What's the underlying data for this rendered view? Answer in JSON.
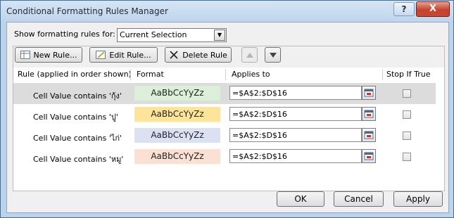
{
  "window": {
    "title": "Conditional Formatting Rules Manager",
    "help_label": "?",
    "close_label": "X"
  },
  "filter": {
    "label": "Show formatting rules for:",
    "selected": "Current Selection"
  },
  "toolbar": {
    "new_rule": "New Rule...",
    "edit_rule": "Edit Rule...",
    "delete_rule": "Delete Rule"
  },
  "columns": {
    "rule": "Rule (applied in order shown)",
    "format": "Format",
    "applies": "Applies to",
    "stop": "Stop If True"
  },
  "rules": [
    {
      "name": "Cell Value contains 'กุ้ง'",
      "preview": "AaBbCcYyZz",
      "fill": "#dcefd8",
      "applies_to": "=$A$2:$D$16",
      "stop_if_true": false
    },
    {
      "name": "Cell Value contains 'ปู'",
      "preview": "AaBbCcYyZz",
      "fill": "#fde49b",
      "applies_to": "=$A$2:$D$16",
      "stop_if_true": false
    },
    {
      "name": "Cell Value contains 'ไก่'",
      "preview": "AaBbCcYyZz",
      "fill": "#dbe1f1",
      "applies_to": "=$A$2:$D$16",
      "stop_if_true": false
    },
    {
      "name": "Cell Value contains 'หมู'",
      "preview": "AaBbCcYyZz",
      "fill": "#fbe1d4",
      "applies_to": "=$A$2:$D$16",
      "stop_if_true": false
    }
  ],
  "footer": {
    "ok": "OK",
    "cancel": "Cancel",
    "apply": "Apply"
  }
}
